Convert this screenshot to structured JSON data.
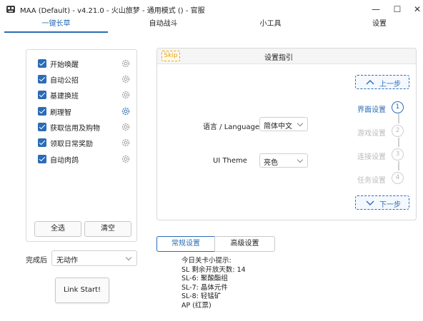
{
  "window": {
    "title": "MAA (Default) - v4.21.0 - 火山旅梦 - 通用模式 () - 官服",
    "minimize_glyph": "—",
    "maximize_glyph": "☐",
    "close_glyph": "✕"
  },
  "tabs": [
    {
      "label": "一键长草",
      "active": true
    },
    {
      "label": "自动战斗",
      "active": false
    },
    {
      "label": "小工具",
      "active": false
    },
    {
      "label": "设置",
      "active": false
    }
  ],
  "tasks": [
    {
      "label": "开始唤醒",
      "checked": true
    },
    {
      "label": "自动公招",
      "checked": true
    },
    {
      "label": "基建换班",
      "checked": true
    },
    {
      "label": "刷理智",
      "checked": true
    },
    {
      "label": "获取信用及购物",
      "checked": true
    },
    {
      "label": "领取日常奖励",
      "checked": true
    },
    {
      "label": "自动肉鸽",
      "checked": true
    }
  ],
  "task_buttons": {
    "select_all": "全选",
    "clear": "清空"
  },
  "after_completion": {
    "label": "完成后",
    "value": "无动作"
  },
  "link_start": "Link Start!",
  "guide": {
    "skip": "Skip",
    "title": "设置指引",
    "language_label": "语言 / Language",
    "language_value": "简体中文",
    "theme_label": "UI Theme",
    "theme_value": "亮色",
    "prev_step": "上一步",
    "next_step": "下一步",
    "steps": [
      {
        "label": "界面设置",
        "number": "1",
        "active": true
      },
      {
        "label": "游戏设置",
        "number": "2",
        "active": false
      },
      {
        "label": "连接设置",
        "number": "3",
        "active": false
      },
      {
        "label": "任务设置",
        "number": "4",
        "active": false
      }
    ]
  },
  "sub_tabs": {
    "regular": "常规设置",
    "advanced": "高级设置"
  },
  "tips": [
    "今日关卡小提示:",
    "SL 剩余开放天数: 14",
    "SL-6: 聚酸酯组",
    "SL-7: 晶体元件",
    "SL-8: 轻锰矿",
    "AP (红票)"
  ],
  "colors": {
    "accent": "#2b6cb5",
    "skip": "#e3a21a",
    "inactive_step": "#bbbbbb"
  }
}
